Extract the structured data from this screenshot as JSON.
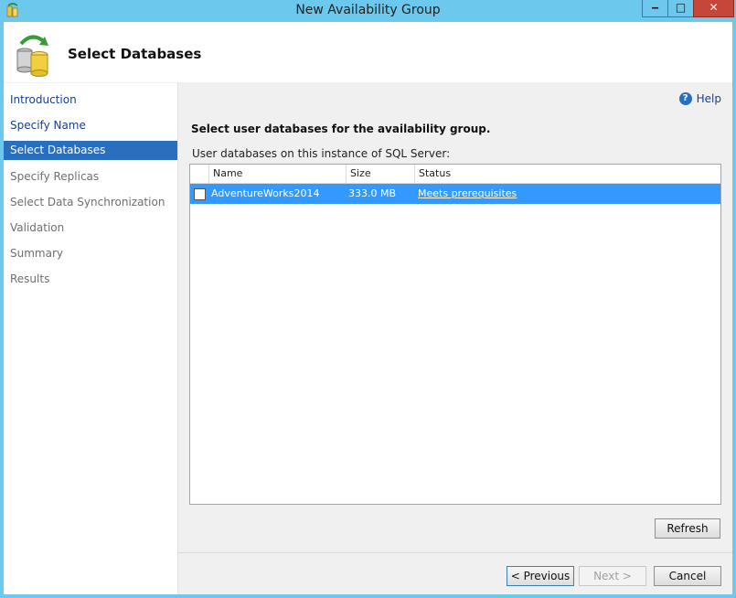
{
  "window": {
    "title": "New Availability Group",
    "minimize_glyph": "‒",
    "maximize_glyph": "□",
    "close_glyph": "✕"
  },
  "header": {
    "title": "Select Databases",
    "icon": "database-sync-icon"
  },
  "nav": {
    "items": [
      {
        "label": "Introduction",
        "state": "link"
      },
      {
        "label": "Specify Name",
        "state": "link"
      },
      {
        "label": "Select Databases",
        "state": "active"
      },
      {
        "label": "Specify Replicas",
        "state": "disabled"
      },
      {
        "label": "Select Data Synchronization",
        "state": "disabled"
      },
      {
        "label": "Validation",
        "state": "disabled"
      },
      {
        "label": "Summary",
        "state": "disabled"
      },
      {
        "label": "Results",
        "state": "disabled"
      }
    ]
  },
  "content": {
    "help_label": "Help",
    "help_icon_glyph": "?",
    "instruction": "Select user databases for the availability group.",
    "list_label": "User databases on this instance of SQL Server:",
    "columns": {
      "name": "Name",
      "size": "Size",
      "status": "Status"
    },
    "rows": [
      {
        "name": "AdventureWorks2014",
        "size": "333.0 MB",
        "status": "Meets prerequisites",
        "checked": false,
        "selected": true
      }
    ]
  },
  "buttons": {
    "refresh": "Refresh",
    "previous": "< Previous",
    "next": "Next >",
    "cancel": "Cancel"
  },
  "colors": {
    "titlebar": "#6cc8ec",
    "selection": "#3399ff",
    "nav_active": "#2a6fbd",
    "close_button": "#c7463a"
  }
}
